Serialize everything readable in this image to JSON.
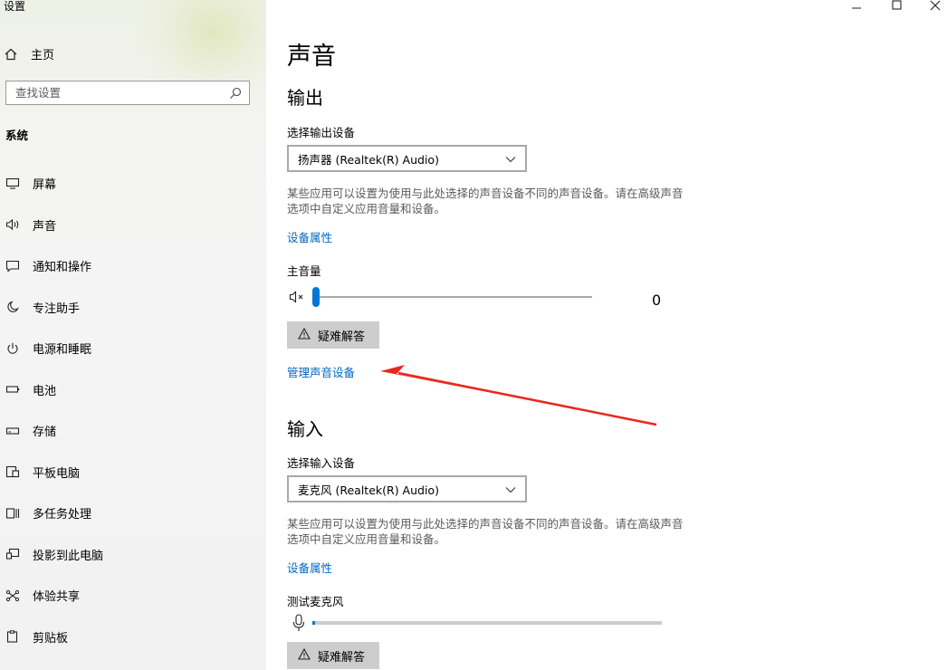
{
  "window": {
    "title": "设置"
  },
  "sidebar": {
    "home_label": "主页",
    "search_placeholder": "查找设置",
    "section_label": "系统",
    "items": [
      {
        "label": "屏幕",
        "icon": "monitor-icon"
      },
      {
        "label": "声音",
        "icon": "speaker-icon"
      },
      {
        "label": "通知和操作",
        "icon": "notification-icon"
      },
      {
        "label": "专注助手",
        "icon": "moon-icon"
      },
      {
        "label": "电源和睡眠",
        "icon": "power-icon"
      },
      {
        "label": "电池",
        "icon": "battery-icon"
      },
      {
        "label": "存储",
        "icon": "storage-icon"
      },
      {
        "label": "平板电脑",
        "icon": "tablet-icon"
      },
      {
        "label": "多任务处理",
        "icon": "multitask-icon"
      },
      {
        "label": "投影到此电脑",
        "icon": "project-icon"
      },
      {
        "label": "体验共享",
        "icon": "share-icon"
      },
      {
        "label": "剪贴板",
        "icon": "clipboard-icon"
      }
    ]
  },
  "main": {
    "title": "声音",
    "output": {
      "heading": "输出",
      "select_label": "选择输出设备",
      "device": "扬声器 (Realtek(R) Audio)",
      "description": "某些应用可以设置为使用与此处选择的声音设备不同的声音设备。请在高级声音选项中自定义应用音量和设备。",
      "properties_link": "设备属性",
      "volume_label": "主音量",
      "volume_value": "0",
      "volume_level": 0,
      "troubleshoot": "疑难解答",
      "manage_link": "管理声音设备"
    },
    "input": {
      "heading": "输入",
      "select_label": "选择输入设备",
      "device": "麦克风 (Realtek(R) Audio)",
      "description": "某些应用可以设置为使用与此处选择的声音设备不同的声音设备。请在高级声音选项中自定义应用音量和设备。",
      "properties_link": "设备属性",
      "test_label": "测试麦克风",
      "troubleshoot": "疑难解答"
    }
  },
  "colors": {
    "accent": "#0078d7",
    "link": "#0067c0",
    "annotation_arrow": "#e8281e"
  }
}
